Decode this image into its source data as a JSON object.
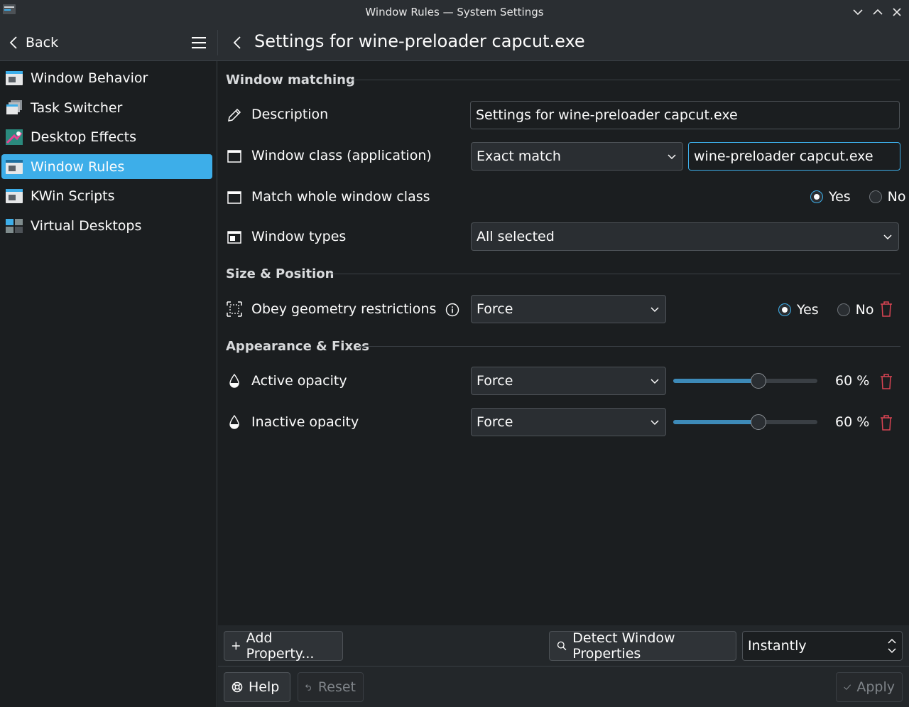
{
  "window": {
    "title": "Window Rules — System Settings"
  },
  "header": {
    "back_label": "Back",
    "page_title": "Settings for wine-preloader capcut.exe"
  },
  "sidebar": {
    "items": [
      {
        "label": "Window Behavior",
        "icon": "window-behavior-icon",
        "active": false
      },
      {
        "label": "Task Switcher",
        "icon": "task-switcher-icon",
        "active": false
      },
      {
        "label": "Desktop Effects",
        "icon": "desktop-effects-icon",
        "active": false
      },
      {
        "label": "Window Rules",
        "icon": "window-rules-icon",
        "active": true
      },
      {
        "label": "KWin Scripts",
        "icon": "kwin-scripts-icon",
        "active": false
      },
      {
        "label": "Virtual Desktops",
        "icon": "virtual-desktops-icon",
        "active": false
      }
    ]
  },
  "sections": {
    "window_matching": "Window matching",
    "size_position": "Size & Position",
    "appearance_fixes": "Appearance & Fixes"
  },
  "rows": {
    "description": {
      "label": "Description",
      "value": "Settings for wine-preloader capcut.exe"
    },
    "window_class": {
      "label": "Window class (application)",
      "match": "Exact match",
      "value": "wine-preloader capcut.exe"
    },
    "match_whole": {
      "label": "Match whole window class",
      "yes": "Yes",
      "no": "No",
      "selected": "Yes"
    },
    "window_types": {
      "label": "Window types",
      "value": "All selected"
    },
    "obey_geometry": {
      "label": "Obey geometry restrictions",
      "policy": "Force",
      "yes": "Yes",
      "no": "No",
      "selected": "Yes"
    },
    "active_opacity": {
      "label": "Active opacity",
      "policy": "Force",
      "value": 60,
      "display": "60 %"
    },
    "inactive_opacity": {
      "label": "Inactive opacity",
      "policy": "Force",
      "value": 60,
      "display": "60 %"
    }
  },
  "footer": {
    "add_property": "Add Property...",
    "detect": "Detect Window Properties",
    "detect_delay": "Instantly",
    "help": "Help",
    "reset": "Reset",
    "apply": "Apply"
  },
  "colors": {
    "accent": "#3daee9",
    "danger": "#da4453",
    "slider_fill": "#3d8ab8"
  }
}
